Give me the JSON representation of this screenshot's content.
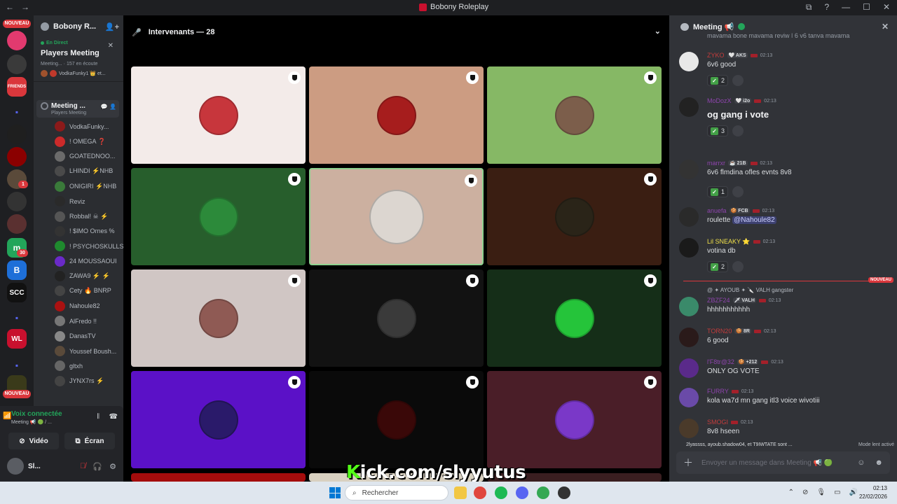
{
  "window": {
    "title": "Bobony Roleplay",
    "nav_back": "←",
    "nav_forward": "→",
    "controls": [
      "⧉",
      "?",
      "—",
      "☐",
      "✕"
    ]
  },
  "server_rail": {
    "new_badge": "NOUVEAU",
    "new_badge_bottom": "NOUVEAU",
    "friends_label": "FRIENDS",
    "b_label": "B",
    "scc_label": "SCC",
    "wl_label": "WL",
    "mention_1": "1",
    "mention_30": "30"
  },
  "channel_sidebar": {
    "server_name": "Bobony R...",
    "live": {
      "tag": "En Direct",
      "title": "Players Meeting",
      "meta": "Meeting... · 157 en écoute",
      "who": "VodkaFunky1 👑 et..."
    },
    "voice_channel": {
      "name": "Meeting ...",
      "sub": "Players Meeting"
    },
    "members": [
      {
        "name": "VodkaFunky...",
        "color": "#8b1a1a"
      },
      {
        "name": "! OMEGA ❓",
        "color": "#cc2a2a"
      },
      {
        "name": "GOATEDNOO...",
        "color": "#6b6b6b"
      },
      {
        "name": "LHINDI ⚡NHB",
        "color": "#4a4a4a"
      },
      {
        "name": "ONIGIRI ⚡NHB",
        "color": "#3a7a3a"
      },
      {
        "name": "Reviz",
        "color": "#2a2a2a"
      },
      {
        "name": "Robbal! ☠ ⚡",
        "color": "#555"
      },
      {
        "name": "! $IMO Ornes %",
        "color": "#333"
      },
      {
        "name": "! PSYCHOSKULLS...",
        "color": "#1f8a2e"
      },
      {
        "name": "24 MOUSSAOUI",
        "color": "#6a2ac8"
      },
      {
        "name": "ZAWA9 ⚡ ⚡",
        "color": "#222"
      },
      {
        "name": "Cety 🔥 BNRP",
        "color": "#444"
      },
      {
        "name": "Nahoule82",
        "color": "#a11"
      },
      {
        "name": "AlFredo !!",
        "color": "#777"
      },
      {
        "name": "DanasTV",
        "color": "#888"
      },
      {
        "name": "Youssef Boush...",
        "color": "#5a4a3a"
      },
      {
        "name": "gltxh",
        "color": "#666"
      },
      {
        "name": "JYNX7rs ⚡",
        "color": "#444"
      }
    ]
  },
  "user_panel": {
    "voice_status": "Voix connectée",
    "voice_sub": "Meeting 📢 🟢 / ...",
    "video_label": "Vidéo",
    "screen_label": "Écran",
    "username": "Sl..."
  },
  "stage": {
    "header": "Intervenants — 28",
    "tiles": [
      {
        "bg": "#f3ebe9",
        "av": "#c7363c"
      },
      {
        "bg": "#cc9c82",
        "av": "#a61d1d"
      },
      {
        "bg": "#86b865",
        "av": "#7c5e4b"
      },
      {
        "bg": "#275e2c",
        "av": "#2c8a3a"
      },
      {
        "bg": "#ccb0a0",
        "av": "#dcd6d0"
      },
      {
        "bg": "#3a1e12",
        "av": "#2a2418"
      },
      {
        "bg": "#d0c6c4",
        "av": "#8f5a54"
      },
      {
        "bg": "#121212",
        "av": "#3a3a3a"
      },
      {
        "bg": "#152e18",
        "av": "#25c43a"
      },
      {
        "bg": "#5b11c7",
        "av": "#2a1a6a"
      },
      {
        "bg": "#0a0a0a",
        "av": "#3a0808"
      },
      {
        "bg": "#4a1e28",
        "av": "#7a38c8"
      }
    ],
    "watermark_k": "K",
    "watermark_rest": "ick.com/slyyutus"
  },
  "chat": {
    "title": "Meeting 📢",
    "messages": [
      {
        "author": "ZYKO",
        "author_color": "#c43c3c",
        "tag": "🤍 AKS",
        "time": "02:13",
        "text": "6v6 good",
        "reaction_count": "2",
        "av": "#e8e8e8"
      },
      {
        "author": "MoDozX",
        "author_color": "#8e44ad",
        "tag": "🤍 i2o",
        "time": "02:13",
        "text": "og gang i vote",
        "reaction_count": "3",
        "av": "#222"
      },
      {
        "author": "marrxr",
        "author_color": "#8e44ad",
        "tag": "☕ 21B",
        "time": "02:13",
        "text": "6v6 flmdina ofles evnts 8v8",
        "reaction_count": "1",
        "av": "#333"
      },
      {
        "author": "anuefa",
        "author_color": "#8e44ad",
        "tag": "🍪 FCB",
        "time": "02:13",
        "text_prefix": "roulette ",
        "mention": "@Nahoule82",
        "av": "#2a2a2a"
      },
      {
        "author": "Lil SNEAKY ⭐",
        "author_color": "#f0e04a",
        "time": "02:13",
        "text": "votina db",
        "reaction_count": "2",
        "av": "#1a1a1a"
      },
      {
        "author": "ZBZF24",
        "author_color": "#8e44ad",
        "tag": "🗡 VALH",
        "time": "02:13",
        "text": "hhhhhhhhhhh",
        "reply": "@‌ ✦ AYOUB ✦ 🔪 VALH gangster",
        "av": "#3a8a6a"
      },
      {
        "author": "TORN20",
        "author_color": "#c43c3c",
        "tag": "🍪 8R",
        "time": "02:13",
        "text": "6 good",
        "av": "#2a1a1a"
      },
      {
        "author": "l'F8tr@32",
        "author_color": "#8e44ad",
        "tag": "🍪 +212",
        "time": "02:13",
        "text": "ONLY OG VOTE",
        "av": "#5a2a8a"
      },
      {
        "author": "FURRY",
        "author_color": "#8e44ad",
        "time": "02:13",
        "text": "kola wa7d mn gang itl3 voice wivotiii",
        "av": "#6a4aa8"
      },
      {
        "author": "SMOGI",
        "author_color": "#c43c3c",
        "time": "02:13",
        "text": "8v8 hseen",
        "av": "#4a3a2a"
      }
    ],
    "top_clipped": "mayama bone mayama  reviw  |  6 v6 tanya mayama",
    "new_label": "NOUVEAU",
    "typing": "2lyassss, ayoub.shadow04, et T9IWTATE sont ...",
    "slowmode": "Mode lent activé",
    "input_placeholder": "Envoyer un message dans Meeting 📢 🟢"
  },
  "taskbar": {
    "search_placeholder": "Rechercher",
    "time": "02:13",
    "date": "22/02/2026"
  }
}
